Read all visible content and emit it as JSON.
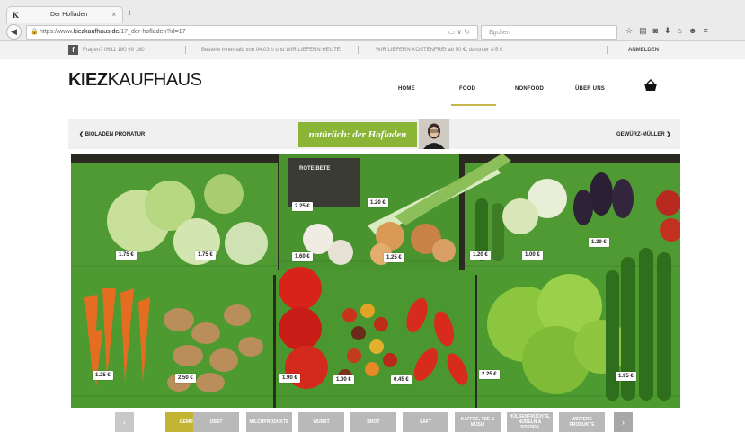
{
  "browser": {
    "tab_title": "Der Hofladen",
    "tab_icon": "K",
    "tab_close": "×",
    "new_tab": "+",
    "url_prefix": "https://www.",
    "url_domain": "kiezkaufhaus.de",
    "url_rest": "/17_der-hofladen?id=17",
    "search_placeholder": "Suchen"
  },
  "topbar": {
    "phone": "Fragen? 0611 180 99 180",
    "delivery": "Bestelle innerhalb von 04:03 h und WIR LIEFERN HEUTE",
    "free": "WIR LIEFERN KOSTENFREI ab 50 €, darunter 3-5 €",
    "login": "ANMELDEN"
  },
  "header": {
    "logo_bold": "KIEZ",
    "logo_light": "KAUFHAUS",
    "nav": [
      "HOME",
      "FOOD",
      "NONFOOD",
      "ÜBER UNS"
    ],
    "active_nav": "FOOD",
    "accent": "#c7b74a"
  },
  "subbar": {
    "prev": "BIOLADEN PRONATUR",
    "current": "natürlich: der Hofladen",
    "next": "GEWÜRZ-MÜLLER",
    "current_color": "#8ab536"
  },
  "hero": {
    "prices": [
      "2.25 €",
      "1.20 €",
      "1.75 €",
      "1.75 €",
      "1.60 €",
      "1.25 €",
      "1.20 €",
      "1.00 €",
      "1.39 €",
      "1.25 €",
      "2.50 €",
      "1.90 €",
      "1.00 €",
      "0.45 €",
      "2.25 €",
      "1.95 €"
    ],
    "bag_label": "ROTE BETE"
  },
  "categories": {
    "items": [
      "GEMÜSE",
      "OBST",
      "MILCHPRODUKTE",
      "WURST",
      "BROT",
      "SAFT",
      "KAFFEE, TEE & MÜSLI",
      "HÜLSENFRÜCHTE, NUDELN & SOSSEN",
      "WEITERE PRODUKTE"
    ],
    "active": "GEMÜSE",
    "prev_arrow": "‹",
    "next_arrow": "›"
  }
}
